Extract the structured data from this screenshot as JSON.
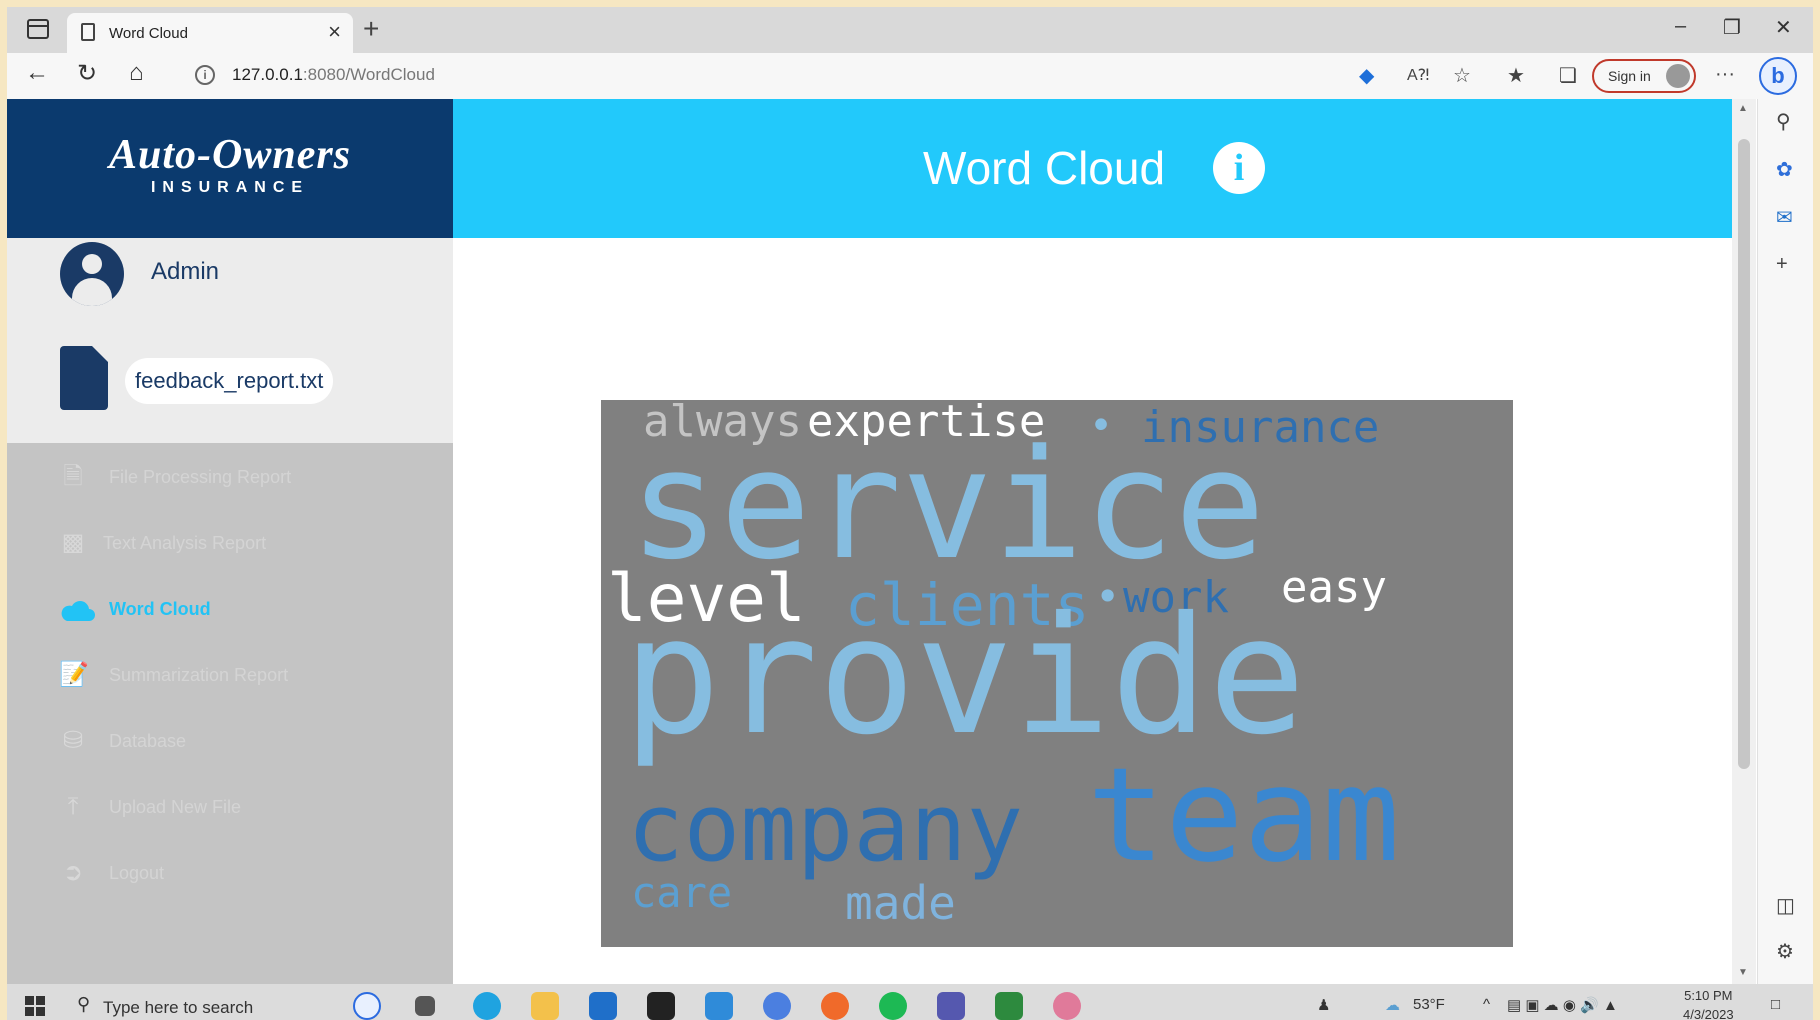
{
  "browser": {
    "tab_title": "Word Cloud",
    "tab_close": "×",
    "new_tab": "+",
    "minimize": "–",
    "restore": "❐",
    "close": "✕",
    "back": "←",
    "refresh": "↻",
    "home": "⌂",
    "info": "i",
    "url_host": "127.0.0.1",
    "url_path": ":8080/WordCloud",
    "sign_in": "Sign in",
    "more": "···",
    "bing": "b"
  },
  "sidebar": {
    "logo_main": "Auto-Owners",
    "logo_sub": "INSURANCE",
    "user_name": "Admin",
    "file_name": "feedback_report.txt",
    "menu": [
      {
        "label": "File Processing Report",
        "icon": "file-processing-icon",
        "active": false
      },
      {
        "label": "Text Analysis Report",
        "icon": "bar-chart-icon",
        "active": false
      },
      {
        "label": "Word Cloud",
        "icon": "cloud-icon",
        "active": true
      },
      {
        "label": "Summarization Report",
        "icon": "file-edit-icon",
        "active": false
      },
      {
        "label": "Database",
        "icon": "database-icon",
        "active": false
      },
      {
        "label": "Upload New File",
        "icon": "upload-icon",
        "active": false
      },
      {
        "label": "Logout",
        "icon": "logout-icon",
        "active": false
      }
    ]
  },
  "main": {
    "title": "Word Cloud",
    "info_glyph": "i",
    "header_color": "#22c9fb"
  },
  "word_cloud": {
    "background": "#808080",
    "words": [
      {
        "text": "always",
        "color": "#c4c4c4"
      },
      {
        "text": "expertise",
        "color": "#ffffff"
      },
      {
        "text": "insurance",
        "color": "#2f6fb0"
      },
      {
        "text": "service",
        "color": "#86bde0"
      },
      {
        "text": "level",
        "color": "#ffffff"
      },
      {
        "text": "clients",
        "color": "#5b9fd1"
      },
      {
        "text": "work",
        "color": "#2f6fb0"
      },
      {
        "text": "easy",
        "color": "#ffffff"
      },
      {
        "text": "provide",
        "color": "#86bde0"
      },
      {
        "text": "company",
        "color": "#2f6fb0"
      },
      {
        "text": "team",
        "color": "#3a87d0"
      },
      {
        "text": "care",
        "color": "#5b9fd1"
      },
      {
        "text": "made",
        "color": "#7fb3dd"
      }
    ]
  },
  "taskbar": {
    "search_placeholder": "Type here to search",
    "weather": "53°F",
    "time": "5:10 PM",
    "date": "4/3/2023"
  }
}
